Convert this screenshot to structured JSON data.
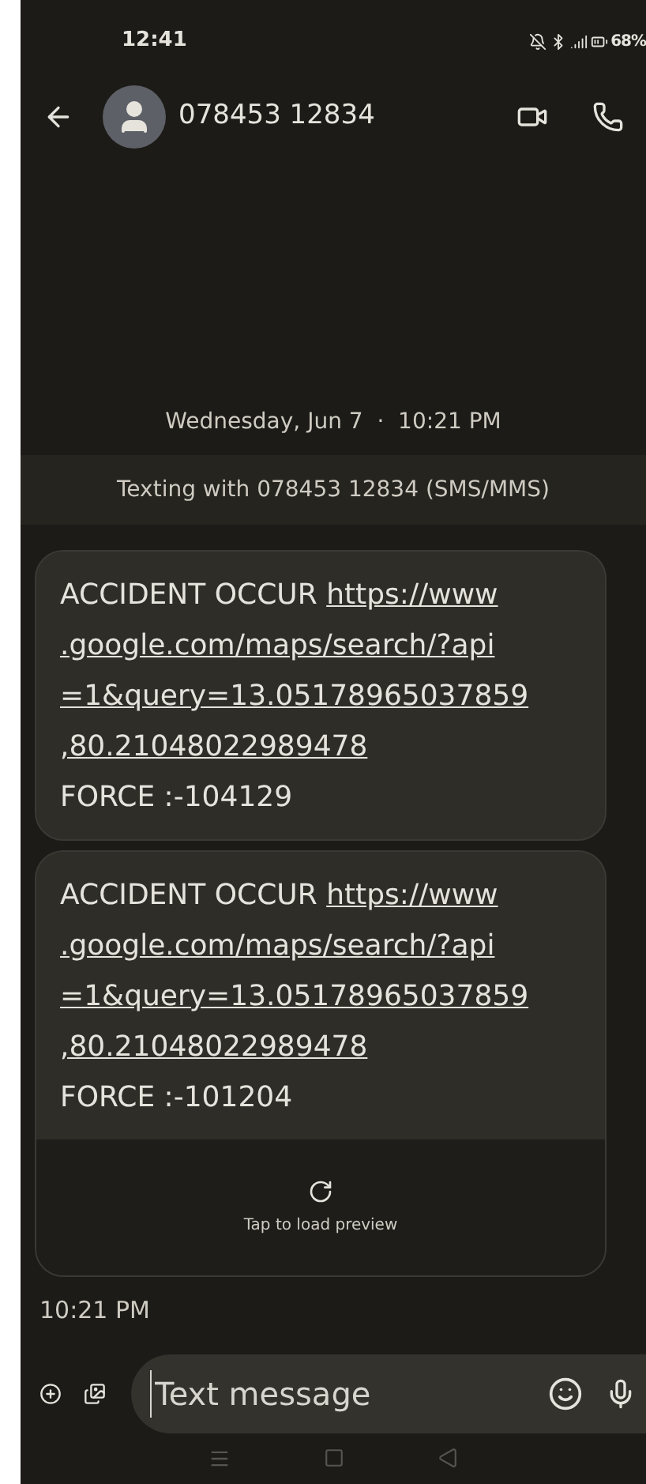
{
  "status_bar": {
    "time": "12:41",
    "battery": "68%"
  },
  "header": {
    "contact": "078453 12834"
  },
  "date_divider": "Wednesday, Jun 7  ·  10:21 PM",
  "texting_notice": "Texting with 078453 12834 (SMS/MMS)",
  "messages": [
    {
      "prefix": "ACCIDENT OCCUR",
      "link_lines": [
        "https://www",
        ".google.com/maps/search/?api",
        "=1&query=13.05178965037859",
        ",80.21048022989478"
      ],
      "footer": "FORCE :-104129"
    },
    {
      "prefix": "ACCIDENT OCCUR",
      "link_lines": [
        "https://www",
        ".google.com/maps/search/?api",
        "=1&query=13.05178965037859",
        ",80.21048022989478"
      ],
      "footer": "FORCE :-101204",
      "preview": "Tap to load preview"
    }
  ],
  "message_time": "10:21 PM",
  "composer": {
    "placeholder": "Text message"
  }
}
